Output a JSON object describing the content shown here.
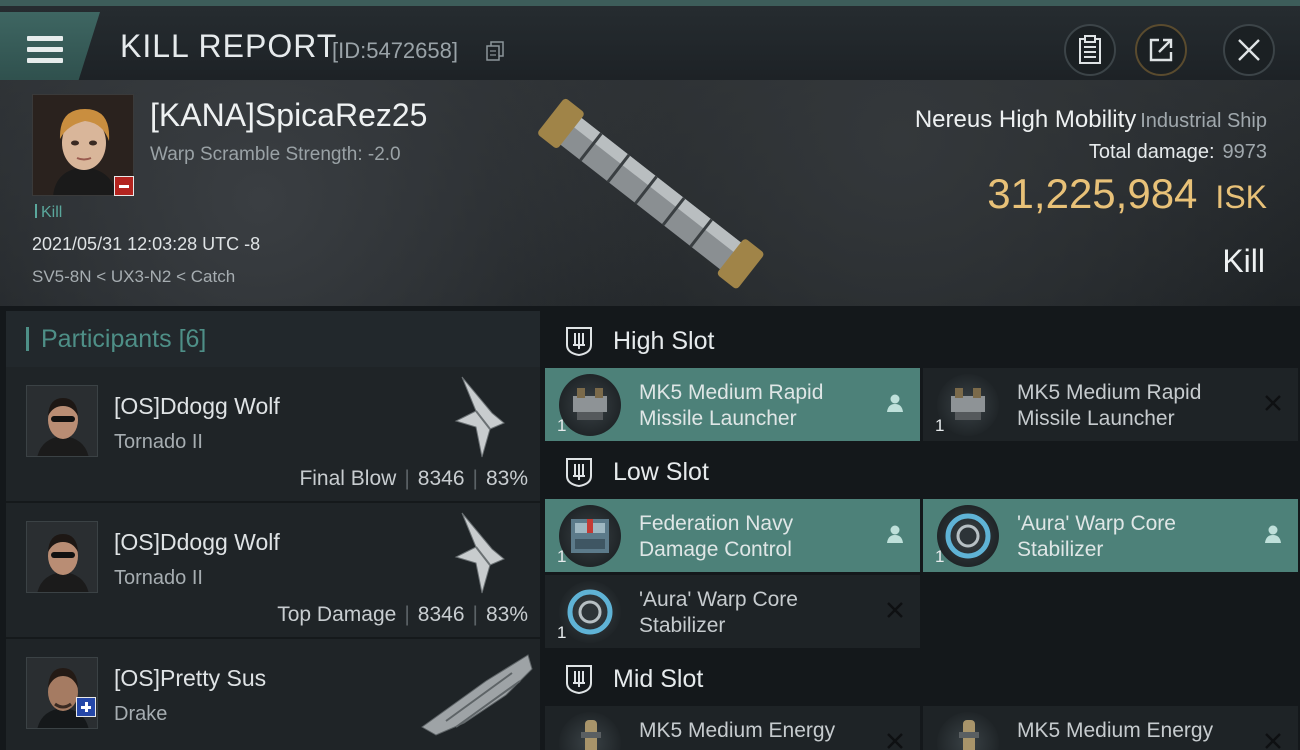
{
  "topbar": {
    "title": "KILL REPORT",
    "report_id": "[ID:5472658]",
    "icons": [
      "menu-icon",
      "copy-icon",
      "clipboard-icon",
      "share-icon",
      "close-icon"
    ]
  },
  "victim": {
    "name": "[KANA]SpicaRez25",
    "warp_scramble": "Warp Scramble Strength: -2.0",
    "tag": "Kill",
    "datetime": "2021/05/31 12:03:28 UTC -8",
    "location": "SV5-8N < UX3-N2 < Catch",
    "ship_name": "Nereus High Mobility",
    "ship_class": "Industrial Ship",
    "total_damage_label": "Total damage:",
    "total_damage": "9973",
    "isk_value": "31,225,984",
    "isk_unit": "ISK",
    "result": "Kill"
  },
  "participants": {
    "header": "Participants",
    "count": "[6]",
    "rows": [
      {
        "name": "[OS]Ddogg Wolf",
        "ship": "Tornado II",
        "role": "Final Blow",
        "damage": "8346",
        "percent": "83%"
      },
      {
        "name": "[OS]Ddogg Wolf",
        "ship": "Tornado II",
        "role": "Top Damage",
        "damage": "8346",
        "percent": "83%"
      },
      {
        "name": "[OS]Pretty Sus",
        "ship": "Drake",
        "role": "",
        "damage": "",
        "percent": ""
      }
    ]
  },
  "slots": {
    "high": {
      "label": "High Slot",
      "modules": [
        {
          "line1": "MK5 Medium Rapid",
          "line2": "Missile Launcher",
          "qty": "1",
          "status": "dropped"
        },
        {
          "line1": "MK5 Medium Rapid",
          "line2": "Missile Launcher",
          "qty": "1",
          "status": "destroyed"
        }
      ]
    },
    "low": {
      "label": "Low Slot",
      "modules": [
        {
          "line1": "Federation Navy",
          "line2": "Damage Control",
          "qty": "1",
          "status": "dropped"
        },
        {
          "line1": "'Aura' Warp Core",
          "line2": "Stabilizer",
          "qty": "1",
          "status": "dropped"
        },
        {
          "line1": "'Aura' Warp Core",
          "line2": "Stabilizer",
          "qty": "1",
          "status": "destroyed"
        }
      ]
    },
    "mid": {
      "label": "Mid Slot",
      "modules": [
        {
          "line1": "MK5 Medium Energy",
          "line2": "",
          "qty": "",
          "status": "destroyed"
        },
        {
          "line1": "MK5 Medium Energy",
          "line2": "",
          "qty": "",
          "status": "destroyed"
        }
      ]
    }
  },
  "colors": {
    "accent_teal": "#4d8179",
    "isk_gold": "#e8c178",
    "loss_red": "#b3241f",
    "standing_blue": "#2547a8"
  }
}
